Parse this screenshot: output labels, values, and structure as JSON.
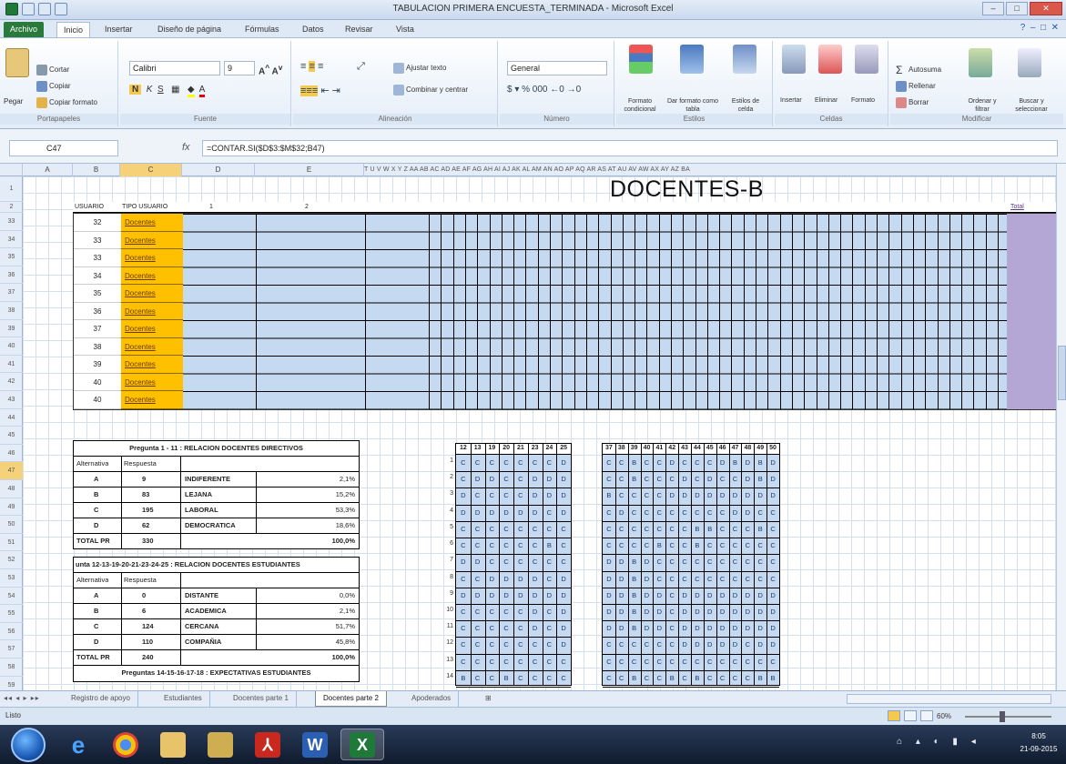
{
  "window": {
    "title": "TABULACION PRIMERA ENCUESTA_TERMINADA - Microsoft Excel"
  },
  "ribbon_tabs": [
    "Archivo",
    "Inicio",
    "Insertar",
    "Diseño de página",
    "Fórmulas",
    "Datos",
    "Revisar",
    "Vista"
  ],
  "ribbon": {
    "clipboard": {
      "paste": "Pegar",
      "cut": "Cortar",
      "copy": "Copiar",
      "format_painter": "Copiar formato",
      "label": "Portapapeles"
    },
    "font": {
      "name": "Calibri",
      "size": "9",
      "label": "Fuente"
    },
    "alignment": {
      "wrap": "Ajustar texto",
      "merge": "Combinar y centrar",
      "label": "Alineación"
    },
    "number": {
      "format": "General",
      "label": "Número"
    },
    "styles": {
      "conditional": "Formato condicional",
      "table": "Dar formato como tabla",
      "cell": "Estilos de celda",
      "label": "Estilos"
    },
    "cells": {
      "insert": "Insertar",
      "delete": "Eliminar",
      "format": "Formato",
      "label": "Celdas"
    },
    "editing": {
      "autosum": "Autosuma",
      "fill": "Rellenar",
      "clear": "Borrar",
      "sort": "Ordenar y filtrar",
      "find": "Buscar y seleccionar",
      "label": "Modificar"
    }
  },
  "formula_bar": {
    "name_box": "C47",
    "fx": "fx",
    "formula": "=CONTAR.SI($D$3:$M$32;B47)"
  },
  "col_headers": {
    "a": "A",
    "b": "B",
    "c": "C",
    "d": "D",
    "e": "E",
    "many": "T U V W X Y Z AA AB AC AD AE AF AG AH AI AJ AK AL AM AN AO AP AQ AR AS AT AU AV AW AX AY AZ BA"
  },
  "row_headers": [
    "1",
    "2",
    "33",
    "34",
    "35",
    "36",
    "37",
    "38",
    "39",
    "40",
    "41",
    "42",
    "43",
    "44",
    "45",
    "46",
    "47",
    "48",
    "49",
    "50",
    "51",
    "52",
    "53",
    "54",
    "55",
    "56",
    "57",
    "58",
    "59"
  ],
  "sheet": {
    "title": "DOCENTES-B",
    "header_usuario": "USUARIO",
    "header_tipo": "TIPO USUARIO",
    "header_1": "1",
    "header_2": "2",
    "header_total": "Total",
    "users": [
      {
        "id": "32",
        "type": "Docentes"
      },
      {
        "id": "33",
        "type": "Docentes"
      },
      {
        "id": "33",
        "type": "Docentes"
      },
      {
        "id": "34",
        "type": "Docentes"
      },
      {
        "id": "35",
        "type": "Docentes"
      },
      {
        "id": "36",
        "type": "Docentes"
      },
      {
        "id": "37",
        "type": "Docentes"
      },
      {
        "id": "38",
        "type": "Docentes"
      },
      {
        "id": "39",
        "type": "Docentes"
      },
      {
        "id": "40",
        "type": "Docentes"
      },
      {
        "id": "40",
        "type": "Docentes"
      }
    ]
  },
  "table1": {
    "title": "Pregunta 1 - 11 : RELACION DOCENTES DIRECTIVOS",
    "col_alt": "Alternativa",
    "col_resp": "Respuesta",
    "rows": [
      {
        "alt": "A",
        "resp": "9",
        "desc": "INDIFERENTE",
        "pct": "2,1%"
      },
      {
        "alt": "B",
        "resp": "83",
        "desc": "LEJANA",
        "pct": "15,2%"
      },
      {
        "alt": "C",
        "resp": "195",
        "desc": "LABORAL",
        "pct": "53,3%"
      },
      {
        "alt": "D",
        "resp": "62",
        "desc": "DEMOCRATICA",
        "pct": "18,6%"
      }
    ],
    "total_label": "TOTAL PR",
    "total_resp": "330",
    "total_pct": "100,0%"
  },
  "table2": {
    "title": "unta 12-13-19-20-21-23-24-25 : RELACION DOCENTES ESTUDIANTES",
    "col_alt": "Alternativa",
    "col_resp": "Respuesta",
    "rows": [
      {
        "alt": "A",
        "resp": "0",
        "desc": "DISTANTE",
        "pct": "0,0%"
      },
      {
        "alt": "B",
        "resp": "6",
        "desc": "ACADEMICA",
        "pct": "2,1%"
      },
      {
        "alt": "C",
        "resp": "124",
        "desc": "CERCANA",
        "pct": "51,7%"
      },
      {
        "alt": "D",
        "resp": "110",
        "desc": "COMPAÑIA",
        "pct": "45,8%"
      }
    ],
    "total_label": "TOTAL PR",
    "total_resp": "240",
    "total_pct": "100,0%",
    "footer": "Preguntas 14-15-16-17-18 : EXPECTATIVAS ESTUDIANTES"
  },
  "grid_left": {
    "headers": [
      "12",
      "13",
      "19",
      "20",
      "21",
      "23",
      "24",
      "25"
    ],
    "row_nums": [
      "1",
      "2",
      "3",
      "4",
      "5",
      "6",
      "7",
      "8",
      "9",
      "10",
      "11",
      "12",
      "13",
      "14"
    ],
    "rows": [
      [
        "C",
        "C",
        "C",
        "C",
        "C",
        "C",
        "C",
        "D"
      ],
      [
        "C",
        "D",
        "D",
        "C",
        "C",
        "D",
        "D",
        "D"
      ],
      [
        "D",
        "C",
        "C",
        "C",
        "C",
        "D",
        "D",
        "D"
      ],
      [
        "D",
        "D",
        "D",
        "D",
        "D",
        "D",
        "C",
        "D"
      ],
      [
        "C",
        "C",
        "C",
        "C",
        "C",
        "C",
        "C",
        "C"
      ],
      [
        "C",
        "C",
        "C",
        "C",
        "C",
        "C",
        "B",
        "C"
      ],
      [
        "D",
        "D",
        "C",
        "C",
        "C",
        "C",
        "C",
        "C"
      ],
      [
        "C",
        "C",
        "D",
        "D",
        "D",
        "D",
        "C",
        "D"
      ],
      [
        "D",
        "D",
        "D",
        "D",
        "D",
        "D",
        "D",
        "D"
      ],
      [
        "C",
        "C",
        "C",
        "C",
        "C",
        "D",
        "C",
        "D"
      ],
      [
        "C",
        "C",
        "C",
        "C",
        "C",
        "D",
        "C",
        "D"
      ],
      [
        "C",
        "C",
        "C",
        "C",
        "C",
        "C",
        "C",
        "D"
      ],
      [
        "C",
        "C",
        "C",
        "C",
        "C",
        "C",
        "C",
        "C"
      ],
      [
        "B",
        "C",
        "C",
        "B",
        "C",
        "C",
        "C",
        "C"
      ]
    ]
  },
  "grid_right": {
    "headers": [
      "37",
      "38",
      "39",
      "40",
      "41",
      "42",
      "43",
      "44",
      "45",
      "46",
      "47",
      "48",
      "49",
      "50"
    ],
    "rows": [
      [
        "C",
        "C",
        "B",
        "C",
        "C",
        "D",
        "C",
        "C",
        "C",
        "D",
        "B",
        "D",
        "B",
        "D"
      ],
      [
        "C",
        "C",
        "B",
        "C",
        "C",
        "C",
        "D",
        "C",
        "D",
        "C",
        "C",
        "D",
        "B",
        "D"
      ],
      [
        "B",
        "C",
        "C",
        "C",
        "C",
        "D",
        "D",
        "D",
        "D",
        "D",
        "D",
        "D",
        "D",
        "D"
      ],
      [
        "C",
        "D",
        "C",
        "C",
        "C",
        "C",
        "C",
        "C",
        "C",
        "C",
        "D",
        "D",
        "C",
        "C"
      ],
      [
        "C",
        "C",
        "C",
        "C",
        "C",
        "C",
        "C",
        "B",
        "B",
        "C",
        "C",
        "C",
        "B",
        "C"
      ],
      [
        "C",
        "C",
        "C",
        "C",
        "B",
        "C",
        "C",
        "B",
        "C",
        "C",
        "C",
        "C",
        "C",
        "C"
      ],
      [
        "D",
        "D",
        "B",
        "D",
        "C",
        "C",
        "C",
        "C",
        "C",
        "C",
        "C",
        "C",
        "C",
        "C"
      ],
      [
        "D",
        "D",
        "B",
        "D",
        "C",
        "C",
        "C",
        "C",
        "C",
        "C",
        "C",
        "C",
        "C",
        "C"
      ],
      [
        "D",
        "D",
        "B",
        "D",
        "D",
        "C",
        "D",
        "D",
        "D",
        "D",
        "D",
        "D",
        "D",
        "D"
      ],
      [
        "D",
        "D",
        "B",
        "D",
        "D",
        "C",
        "D",
        "D",
        "D",
        "D",
        "D",
        "D",
        "D",
        "D"
      ],
      [
        "D",
        "D",
        "B",
        "D",
        "D",
        "C",
        "D",
        "D",
        "D",
        "D",
        "D",
        "D",
        "D",
        "D"
      ],
      [
        "C",
        "C",
        "C",
        "C",
        "C",
        "C",
        "D",
        "D",
        "D",
        "D",
        "D",
        "C",
        "D",
        "D"
      ],
      [
        "C",
        "C",
        "C",
        "C",
        "C",
        "C",
        "C",
        "C",
        "C",
        "C",
        "C",
        "C",
        "C",
        "C"
      ],
      [
        "C",
        "C",
        "B",
        "C",
        "C",
        "B",
        "C",
        "B",
        "C",
        "C",
        "C",
        "C",
        "B",
        "B"
      ]
    ]
  },
  "sheet_tabs": [
    "Registro de apoyo",
    "Estudiantes",
    "Docentes parte 1",
    "Docentes parte 2",
    "Apoderados"
  ],
  "status": {
    "ready": "Listo",
    "zoom": "60%"
  },
  "clock": {
    "time": "8:05",
    "date": "21-09-2015"
  }
}
